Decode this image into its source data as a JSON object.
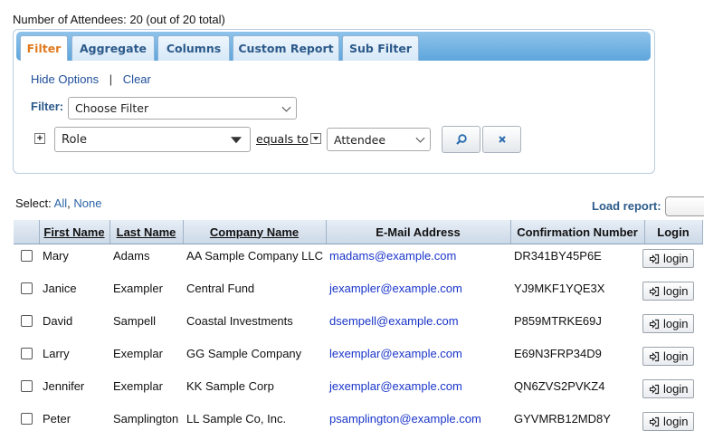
{
  "summary": "Number of Attendees: 20 (out of 20 total)",
  "tabs": [
    {
      "label": "Filter",
      "active": true
    },
    {
      "label": "Aggregate",
      "active": false
    },
    {
      "label": "Columns",
      "active": false
    },
    {
      "label": "Custom Report",
      "active": false
    },
    {
      "label": "Sub Filter",
      "active": false
    }
  ],
  "options": {
    "hide": "Hide Options",
    "separator": "|",
    "clear": "Clear"
  },
  "filter": {
    "label": "Filter:",
    "choose_value": "Choose Filter",
    "plus": "+",
    "field_value": "Role",
    "operator_label": "equals to",
    "value_selected": "Attendee"
  },
  "select": {
    "label": "Select:",
    "all": "All",
    "comma": ",",
    "none": "None"
  },
  "load_report_label": "Load report:",
  "table": {
    "columns": [
      "First Name",
      "Last Name",
      "Company Name",
      "E-Mail Address",
      "Confirmation Number",
      "Login"
    ],
    "login_label": "login",
    "rows": [
      {
        "first": "Mary",
        "last": "Adams",
        "company": "AA Sample Company LLC",
        "email": "madams@example.com",
        "conf": "DR341BY45P6E"
      },
      {
        "first": "Janice",
        "last": "Exampler",
        "company": "Central Fund",
        "email": "jexampler@example.com",
        "conf": "YJ9MKF1YQE3X"
      },
      {
        "first": "David",
        "last": "Sampell",
        "company": "Coastal Investments",
        "email": "dsempell@example.com",
        "conf": "P859MTRKE69J"
      },
      {
        "first": "Larry",
        "last": "Exemplar",
        "company": "GG Sample Company",
        "email": "lexemplar@example.com",
        "conf": "E69N3FRP34D9"
      },
      {
        "first": "Jennifer",
        "last": "Exemplar",
        "company": "KK Sample Corp",
        "email": "jexemplar@example.com",
        "conf": "QN6ZVS2PVKZ4"
      },
      {
        "first": "Peter",
        "last": "Samplington",
        "company": "LL Sample Co, Inc.",
        "email": "psamplington@example.com",
        "conf": "GYVMRB12MD8Y"
      }
    ]
  },
  "colors": {
    "tab_active": "#e07a1f",
    "link": "#1f4e9a",
    "email": "#1a35c9",
    "tabbar": "#6aaee0"
  }
}
